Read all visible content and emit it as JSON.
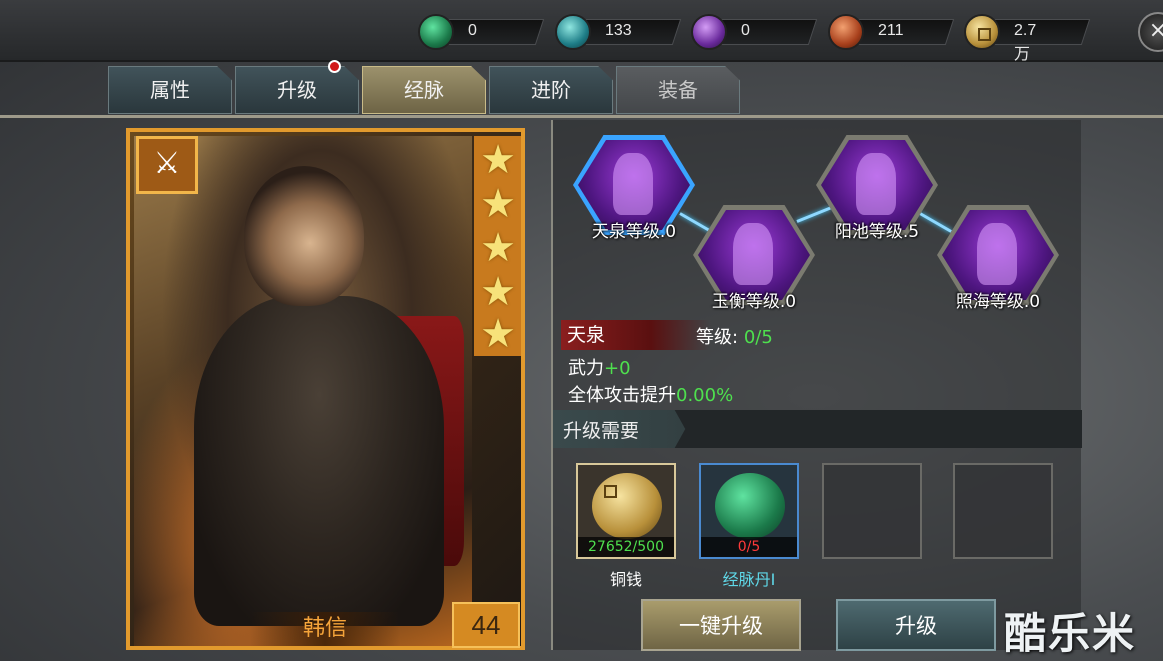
{
  "resources": [
    {
      "icon": "jade-green-icon",
      "value": "0"
    },
    {
      "icon": "jade-teal-icon",
      "value": "133"
    },
    {
      "icon": "jade-purple-icon",
      "value": "0"
    },
    {
      "icon": "meat-icon",
      "value": "211"
    },
    {
      "icon": "coin-icon",
      "value": "2.7万"
    }
  ],
  "tabs": [
    "属性",
    "升级",
    "经脉",
    "进阶",
    "装备"
  ],
  "active_tab": "经脉",
  "hero": {
    "name": "韩信",
    "level": "44",
    "stars": 5
  },
  "meridians": [
    {
      "label": "天泉等级.0",
      "active": true
    },
    {
      "label": "玉衡等级.0",
      "active": false
    },
    {
      "label": "阳池等级.5",
      "active": false
    },
    {
      "label": "照海等级.0",
      "active": false
    }
  ],
  "acupoint": {
    "name": "天泉",
    "level_label": "等级:",
    "level_value": "0/5",
    "stat1_label": "武力",
    "stat1_value": "+0",
    "stat2_label": "全体攻击提升",
    "stat2_value": "0.00%"
  },
  "requirements": {
    "title": "升级需要",
    "items": [
      {
        "label": "铜钱",
        "count": "27652/500",
        "label_color": "#ffffff"
      },
      {
        "label": "经脉丹I",
        "count": "0/5",
        "label_color": "#5fd8e8"
      }
    ]
  },
  "buttons": {
    "one_click": "一键升级",
    "upgrade": "升级"
  },
  "watermark": "酷乐米"
}
